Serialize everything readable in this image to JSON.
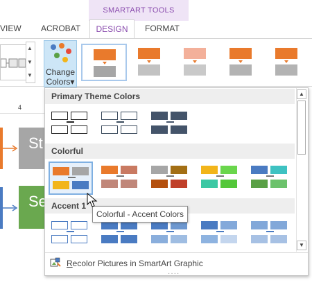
{
  "ribbon": {
    "contextual_group": "SMARTART TOOLS",
    "tabs": [
      {
        "label": "VIEW"
      },
      {
        "label": "ACROBAT"
      },
      {
        "label": "DESIGN",
        "active": true
      },
      {
        "label": "FORMAT"
      }
    ],
    "change_colors": {
      "label_line1": "Change",
      "label_line2": "Colors",
      "dropdown_caret": "▾",
      "dot_colors": [
        "#4a7bc2",
        "#e97a2c",
        "#e84a3c",
        "#5aa046",
        "#f2b51a"
      ]
    },
    "style_gallery_colors": [
      {
        "top": "#e97a2c",
        "bottom": "#a6a6a6"
      },
      {
        "top": "#e97a2c",
        "bottom": "#c2c2c2"
      },
      {
        "top": "#f3b09a",
        "bottom": "#c9c9c9"
      },
      {
        "top": "#e97a2c",
        "bottom": "#b3b3b3"
      },
      {
        "top": "#e97a2c",
        "bottom": "#b3b3b3"
      }
    ]
  },
  "ruler": {
    "mark": "4"
  },
  "document": {
    "shape1_text": "St",
    "shape2_text": "Se"
  },
  "gallery": {
    "sections": [
      {
        "title": "Primary Theme Colors"
      },
      {
        "title": "Colorful"
      },
      {
        "title": "Accent 1"
      }
    ],
    "primary_swatches": [
      {
        "style": "outline",
        "border": "#222222",
        "fill": "#ffffff",
        "conn": "#222222"
      },
      {
        "style": "outline",
        "border": "#3a4a5c",
        "fill": "#ffffff",
        "conn": "#3a4a5c"
      },
      {
        "style": "filled",
        "fill": "#44546a",
        "conn": "#44546a"
      }
    ],
    "colorful_swatches": [
      {
        "cells": [
          "#e97a2c",
          "#a6a6a6",
          "#f2b51a",
          "#4a7bc2"
        ],
        "selected": true
      },
      {
        "cells": [
          "#e97a2c",
          "#c97a62",
          "#c0877a",
          "#c0877a"
        ],
        "selected": false
      },
      {
        "cells": [
          "#a6a6a6",
          "#a36f14",
          "#b4500e",
          "#c0402a"
        ],
        "selected": false
      },
      {
        "cells": [
          "#f2b51a",
          "#6ad64c",
          "#3cc8a4",
          "#54c73a"
        ],
        "selected": false
      },
      {
        "cells": [
          "#4a7bc2",
          "#3ec2c2",
          "#5aa046",
          "#6cc26c"
        ],
        "selected": false
      }
    ],
    "accent_swatches": [
      {
        "cells": [
          "#ffffff",
          "#ffffff",
          "#ffffff",
          "#ffffff"
        ],
        "border": "#4a7bc2"
      },
      {
        "cells": [
          "#4a7bc2",
          "#4a7bc2",
          "#4a7bc2",
          "#4a7bc2"
        ]
      },
      {
        "cells": [
          "#4a7bc2",
          "#6e98d0",
          "#8aaedc",
          "#9fbde2"
        ]
      },
      {
        "cells": [
          "#4a7bc2",
          "#83a9da",
          "#8eb3e0",
          "#c4d6ee"
        ]
      },
      {
        "cells": [
          "#82a8d9",
          "#82a8d9",
          "#a7c1e4",
          "#a7c1e4"
        ]
      }
    ],
    "tooltip": "Colorful - Accent Colors",
    "footer_label": "Recolor Pictures in SmartArt Graphic",
    "footer_underline_char": "R",
    "resize_grip": "····"
  }
}
